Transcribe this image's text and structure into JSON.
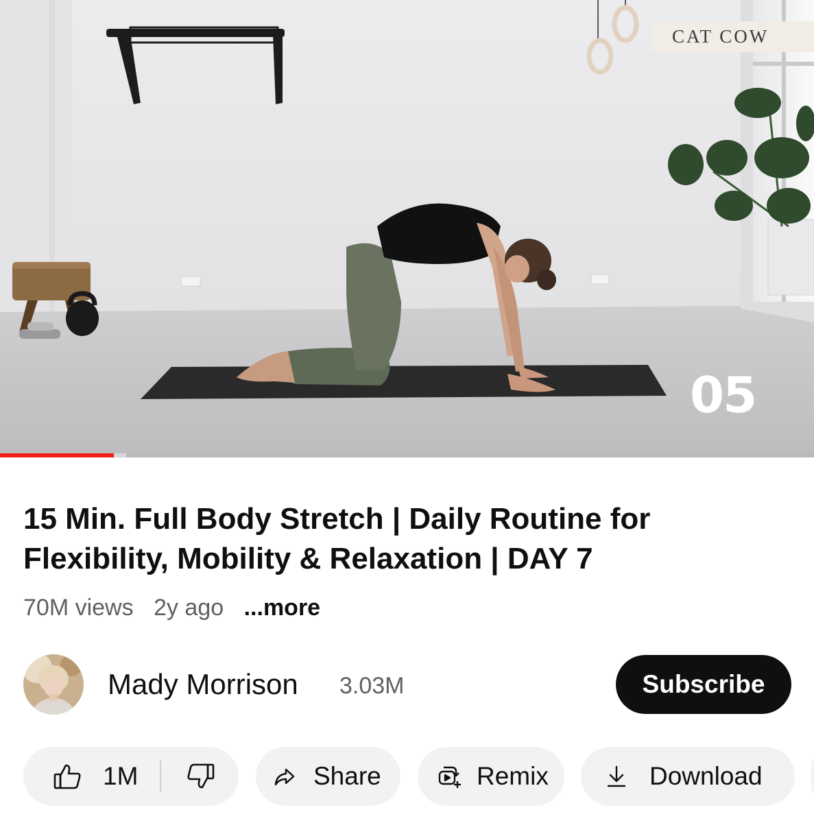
{
  "player": {
    "chapter_label": "CAT COW",
    "chapter_number": "05",
    "progress_played": 0.14,
    "progress_buffered": 0.155
  },
  "video": {
    "title": "15 Min. Full Body Stretch | Daily Routine for Flexibility, Mobility & Relaxation | DAY 7",
    "views": "70M views",
    "age": "2y ago",
    "more_label": "...more"
  },
  "channel": {
    "name": "Mady Morrison",
    "subscribers": "3.03M",
    "subscribe_label": "Subscribe"
  },
  "actions": {
    "like_count": "1M",
    "share_label": "Share",
    "remix_label": "Remix",
    "download_label": "Download"
  },
  "icons": [
    "thumbs-up-icon",
    "thumbs-down-icon",
    "share-arrow-icon",
    "remix-icon",
    "download-icon"
  ],
  "colors": {
    "progress_red": "#f01e16",
    "subscribe_bg": "#0f0f0f",
    "chip_bg": "#f2f2f2",
    "secondary_text": "#606060"
  }
}
